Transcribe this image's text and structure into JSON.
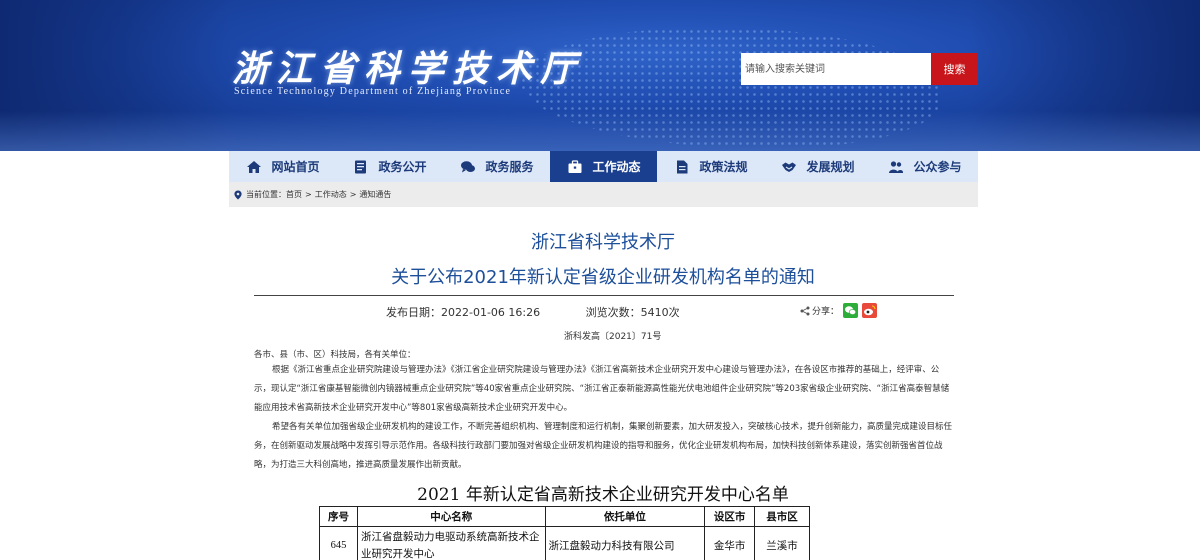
{
  "header": {
    "logo_cn": "浙江省科学技术厅",
    "logo_en": "Science Technology Department of Zhejiang Province",
    "search_placeholder": "请输入搜索关键词",
    "search_button": "搜索"
  },
  "nav": {
    "items": [
      {
        "label": "网站首页",
        "icon": "home-icon"
      },
      {
        "label": "政务公开",
        "icon": "document-icon"
      },
      {
        "label": "政务服务",
        "icon": "chat-icon"
      },
      {
        "label": "工作动态",
        "icon": "briefcase-icon",
        "active": true
      },
      {
        "label": "政策法规",
        "icon": "file-icon"
      },
      {
        "label": "发展规划",
        "icon": "handshake-icon"
      },
      {
        "label": "公众参与",
        "icon": "people-icon"
      }
    ]
  },
  "breadcrumb": {
    "prefix": "当前位置：",
    "items": [
      "首页",
      "工作动态",
      "通知通告"
    ],
    "separator": ">"
  },
  "article": {
    "org": "浙江省科学技术厅",
    "title": "关于公布2021年新认定省级企业研发机构名单的通知",
    "publish_label": "发布日期：",
    "publish_date": "2022-01-06 16:26",
    "views_label": "浏览次数：",
    "views": "5410次",
    "share_label": "分享：",
    "doc_no": "浙科发高〔2021〕71号",
    "salutation": "各市、县（市、区）科技局，各有关单位：",
    "paragraph1": "根据《浙江省重点企业研究院建设与管理办法》《浙江省企业研究院建设与管理办法》《浙江省高新技术企业研究开发中心建设与管理办法》，在各设区市推荐的基础上，经评审、公示，现认定“浙江省康基智能微创内镜器械重点企业研究院”等40家省重点企业研究院、“浙江省正泰新能源高性能光伏电池组件企业研究院”等203家省级企业研究院、“浙江省高泰智慧储能应用技术省高新技术企业研究开发中心”等801家省级高新技术企业研究开发中心。",
    "paragraph2": "希望各有关单位加强省级企业研发机构的建设工作，不断完善组织机构、管理制度和运行机制，集聚创新要素，加大研发投入，突破核心技术，提升创新能力，高质量完成建设目标任务，在创新驱动发展战略中发挥引导示范作用。各级科技行政部门要加强对省级企业研发机构建设的指导和服务，优化企业研发机构布局，加快科技创新体系建设，落实创新强省首位战略，为打造三大科创高地，推进高质量发展作出新贡献。",
    "list_title": "2021 年新认定省高新技术企业研究开发中心名单"
  },
  "table": {
    "headers": [
      "序号",
      "中心名称",
      "依托单位",
      "设区市",
      "县市区"
    ],
    "rows": [
      {
        "no": "645",
        "name": "浙江省盘毅动力电驱动系统高新技术企业研究开发中心",
        "unit": "浙江盘毅动力科技有限公司",
        "city": "金华市",
        "county": "兰溪市"
      }
    ]
  },
  "colors": {
    "banner": "#1f4cb0",
    "nav_bg": "#dce8f7",
    "nav_active": "#1a3f8e",
    "title": "#1d4f9a",
    "search_button": "#c8151b"
  }
}
